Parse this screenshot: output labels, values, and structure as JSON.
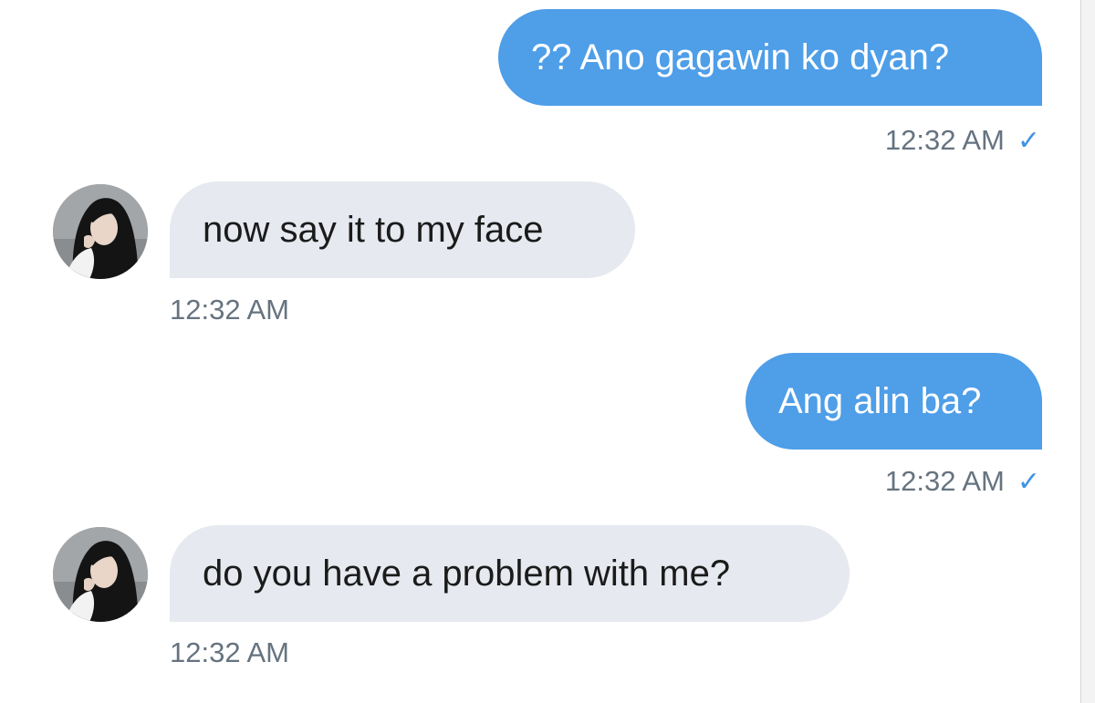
{
  "messages": [
    {
      "direction": "sent",
      "text": "?? Ano gagawin ko dyan?",
      "time": "12:32 AM",
      "status_icon": "check-icon"
    },
    {
      "direction": "received",
      "text": "now say it to my face",
      "time": "12:32 AM",
      "avatar_icon": "avatar-photo"
    },
    {
      "direction": "sent",
      "text": "Ang alin ba?",
      "time": "12:32 AM",
      "status_icon": "check-icon"
    },
    {
      "direction": "received",
      "text": "do you have a problem with me?",
      "time": "12:32 AM",
      "avatar_icon": "avatar-photo"
    }
  ],
  "check_glyph": "✓",
  "colors": {
    "sent_bubble": "#4e9ee8",
    "received_bubble": "#e6e9ef",
    "timestamp": "#667380",
    "read_check": "#3f93e3"
  }
}
